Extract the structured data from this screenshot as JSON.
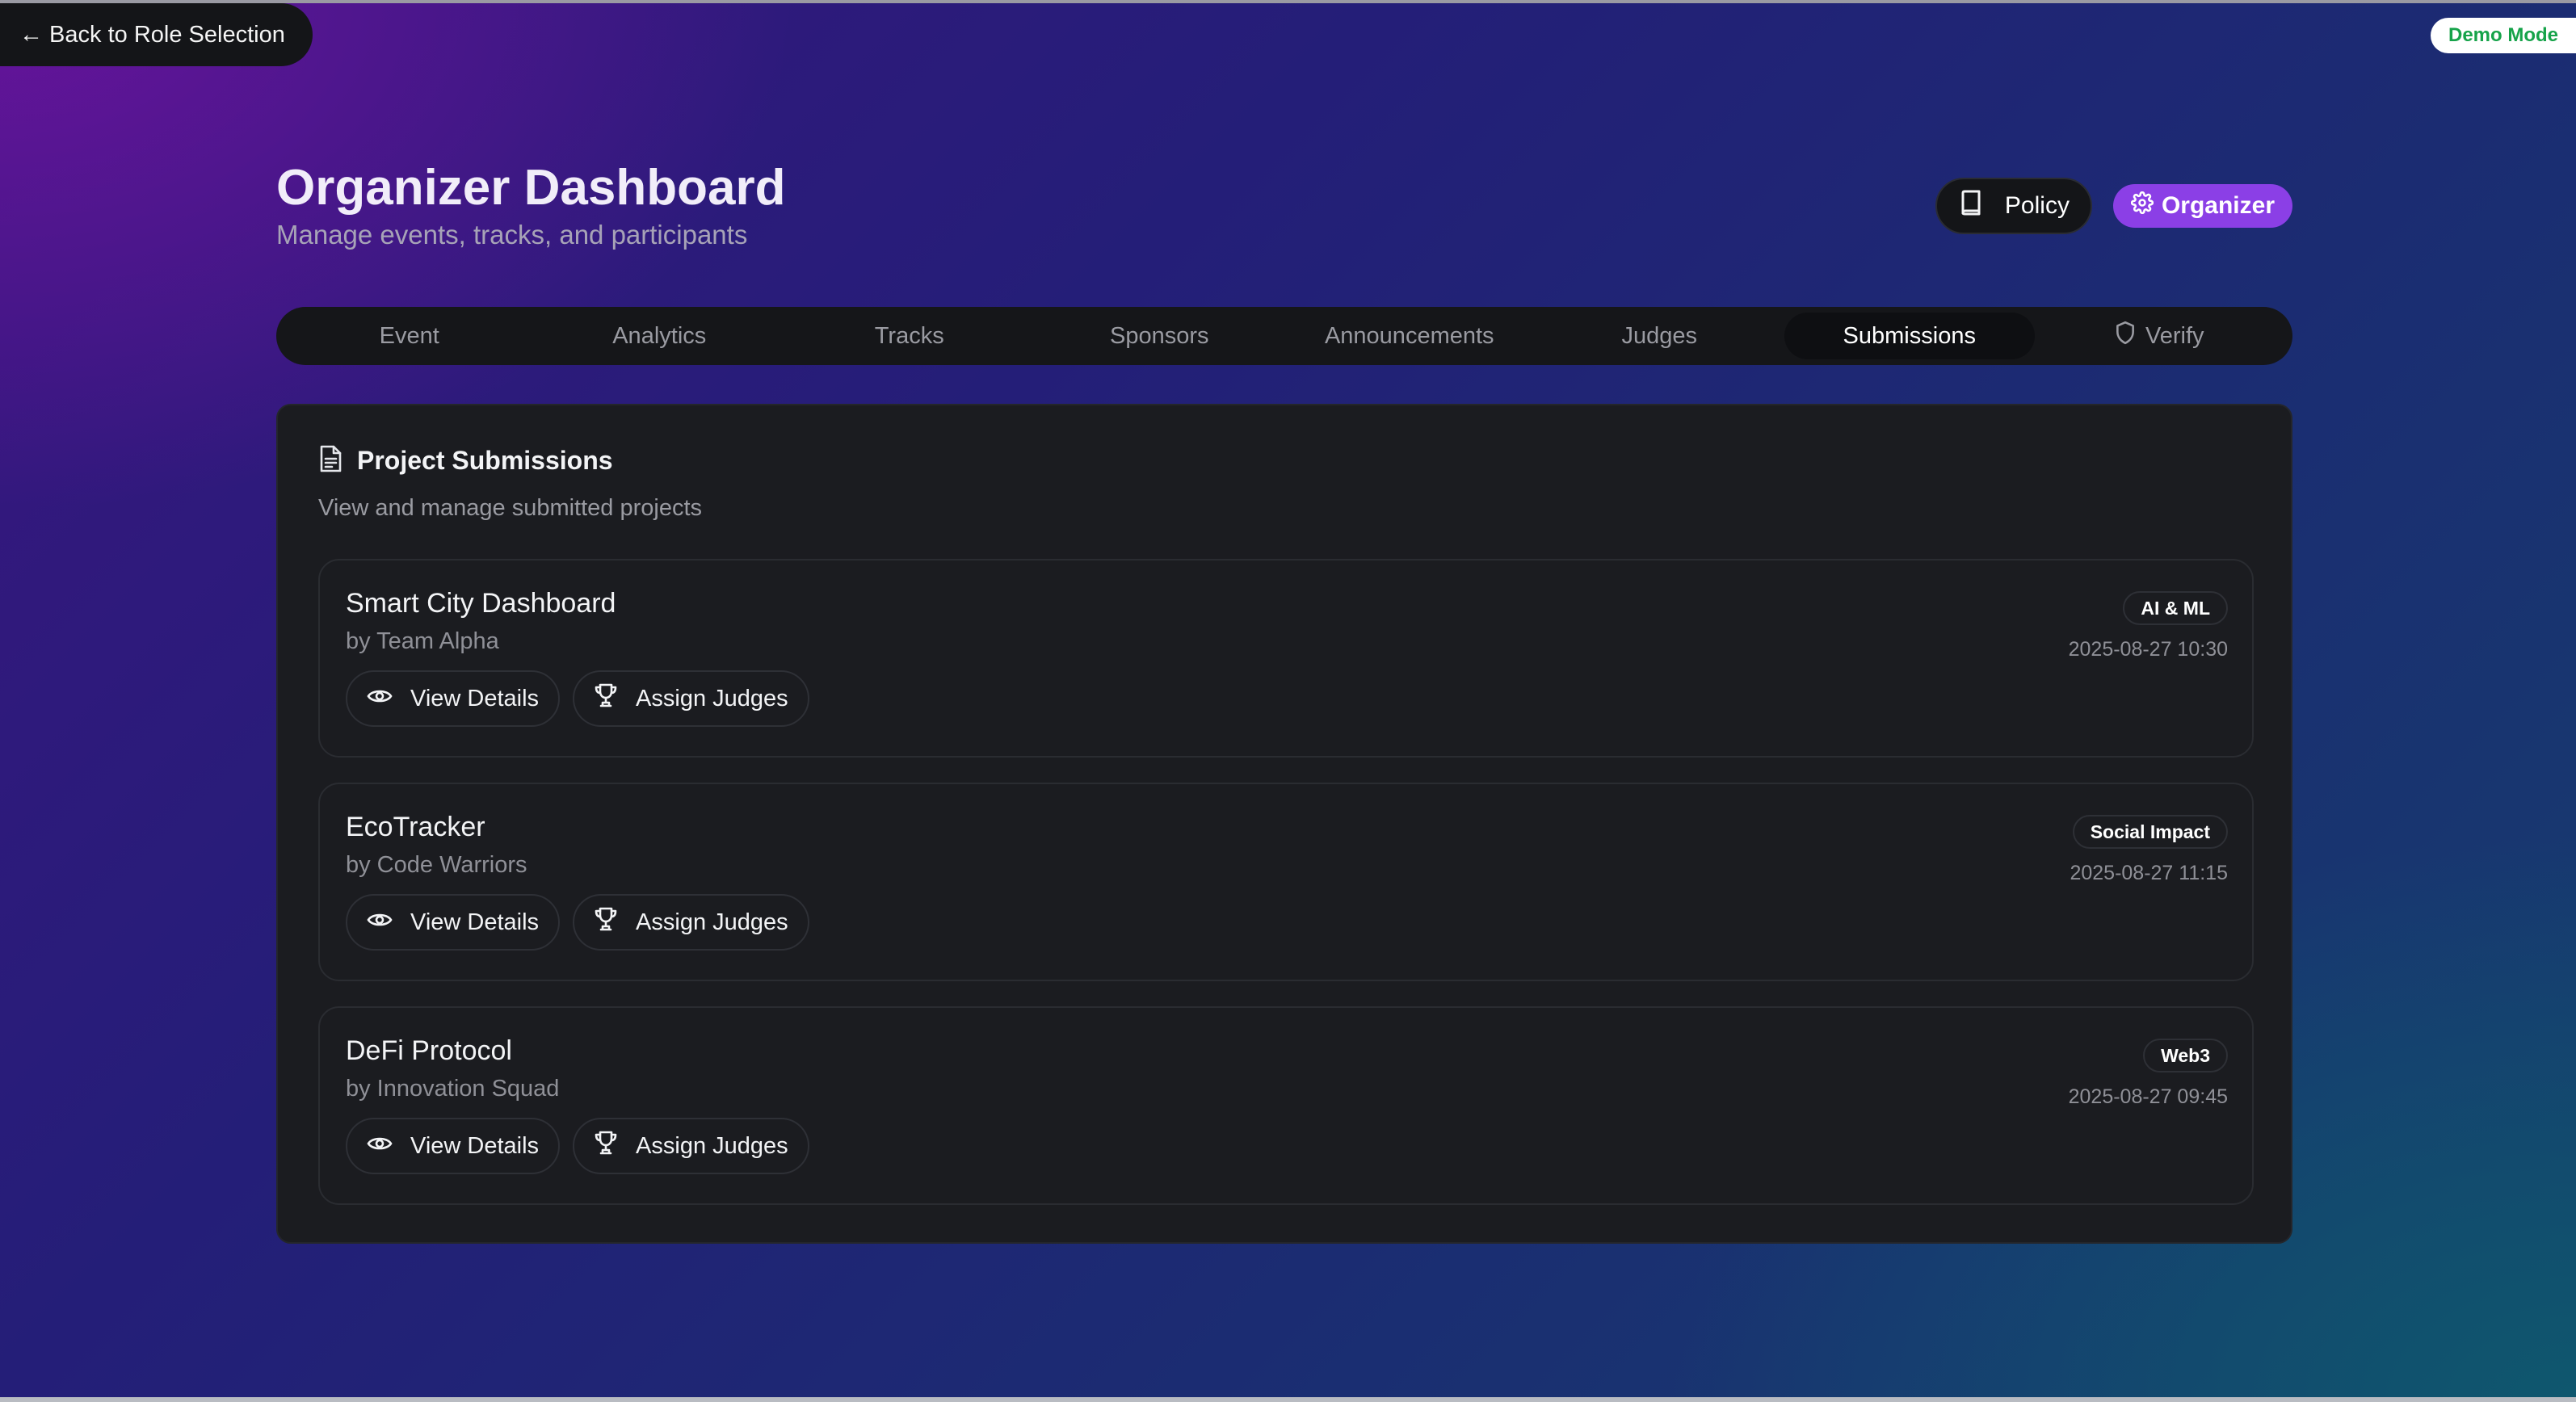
{
  "nav": {
    "back_label": "← Back to Role Selection",
    "demo_badge": "Demo Mode"
  },
  "header": {
    "title": "Organizer Dashboard",
    "subtitle": "Manage events, tracks, and participants",
    "policy_label": "Policy",
    "role_label": "Organizer"
  },
  "tabs": [
    {
      "label": "Event",
      "active": false
    },
    {
      "label": "Analytics",
      "active": false
    },
    {
      "label": "Tracks",
      "active": false
    },
    {
      "label": "Sponsors",
      "active": false
    },
    {
      "label": "Announcements",
      "active": false
    },
    {
      "label": "Judges",
      "active": false
    },
    {
      "label": "Submissions",
      "active": true
    },
    {
      "label": "Verify",
      "active": false,
      "icon": "shield-icon"
    }
  ],
  "submissions_panel": {
    "title": "Project Submissions",
    "description": "View and manage submitted projects",
    "view_details_label": "View Details",
    "assign_judges_label": "Assign Judges",
    "items": [
      {
        "name": "Smart City Dashboard",
        "team": "by Team Alpha",
        "track": "AI & ML",
        "submitted": "2025-08-27 10:30"
      },
      {
        "name": "EcoTracker",
        "team": "by Code Warriors",
        "track": "Social Impact",
        "submitted": "2025-08-27 11:15"
      },
      {
        "name": "DeFi Protocol",
        "team": "by Innovation Squad",
        "track": "Web3",
        "submitted": "2025-08-27 09:45"
      }
    ]
  },
  "colors": {
    "accent": "#8b3fe6",
    "demo_text": "#16a34a",
    "panel_bg": "#1b1c20",
    "tabbar_bg": "#151619"
  }
}
